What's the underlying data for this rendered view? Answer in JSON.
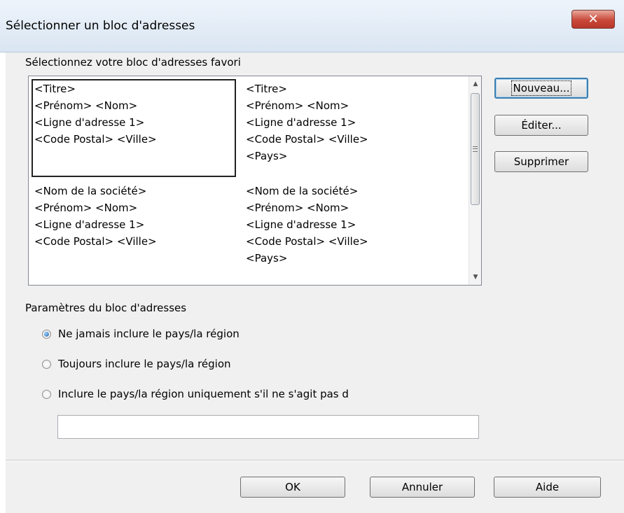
{
  "window": {
    "title": "Sélectionner un bloc d'adresses",
    "close_glyph": "✕"
  },
  "favorites": {
    "label": "Sélectionnez votre bloc d'adresses favori",
    "blocks": [
      {
        "lines": [
          "<Titre>",
          "<Prénom> <Nom>",
          "<Ligne d'adresse 1>",
          "<Code Postal> <Ville>"
        ]
      },
      {
        "lines": [
          "<Titre>",
          "<Prénom> <Nom>",
          "<Ligne d'adresse 1>",
          "<Code Postal> <Ville>",
          "<Pays>"
        ]
      },
      {
        "lines": [
          "<Nom de la société>",
          "<Prénom> <Nom>",
          "<Ligne d'adresse 1>",
          "<Code Postal> <Ville>"
        ]
      },
      {
        "lines": [
          "<Nom de la société>",
          "<Prénom> <Nom>",
          "<Ligne d'adresse 1>",
          "<Code Postal> <Ville>",
          "<Pays>"
        ]
      }
    ],
    "selected_index": 0
  },
  "side_buttons": {
    "new": "Nouveau...",
    "edit": "Éditer...",
    "delete": "Supprimer"
  },
  "settings": {
    "label": "Paramètres du bloc d'adresses",
    "options": [
      {
        "label": "Ne jamais inclure le pays/la région",
        "checked": true
      },
      {
        "label": "Toujours inclure le pays/la région",
        "checked": false
      },
      {
        "label": "Inclure le pays/la région uniquement s'il ne s'agit pas d",
        "checked": false
      }
    ],
    "country_value": ""
  },
  "footer": {
    "ok": "OK",
    "cancel": "Annuler",
    "help": "Aide"
  }
}
